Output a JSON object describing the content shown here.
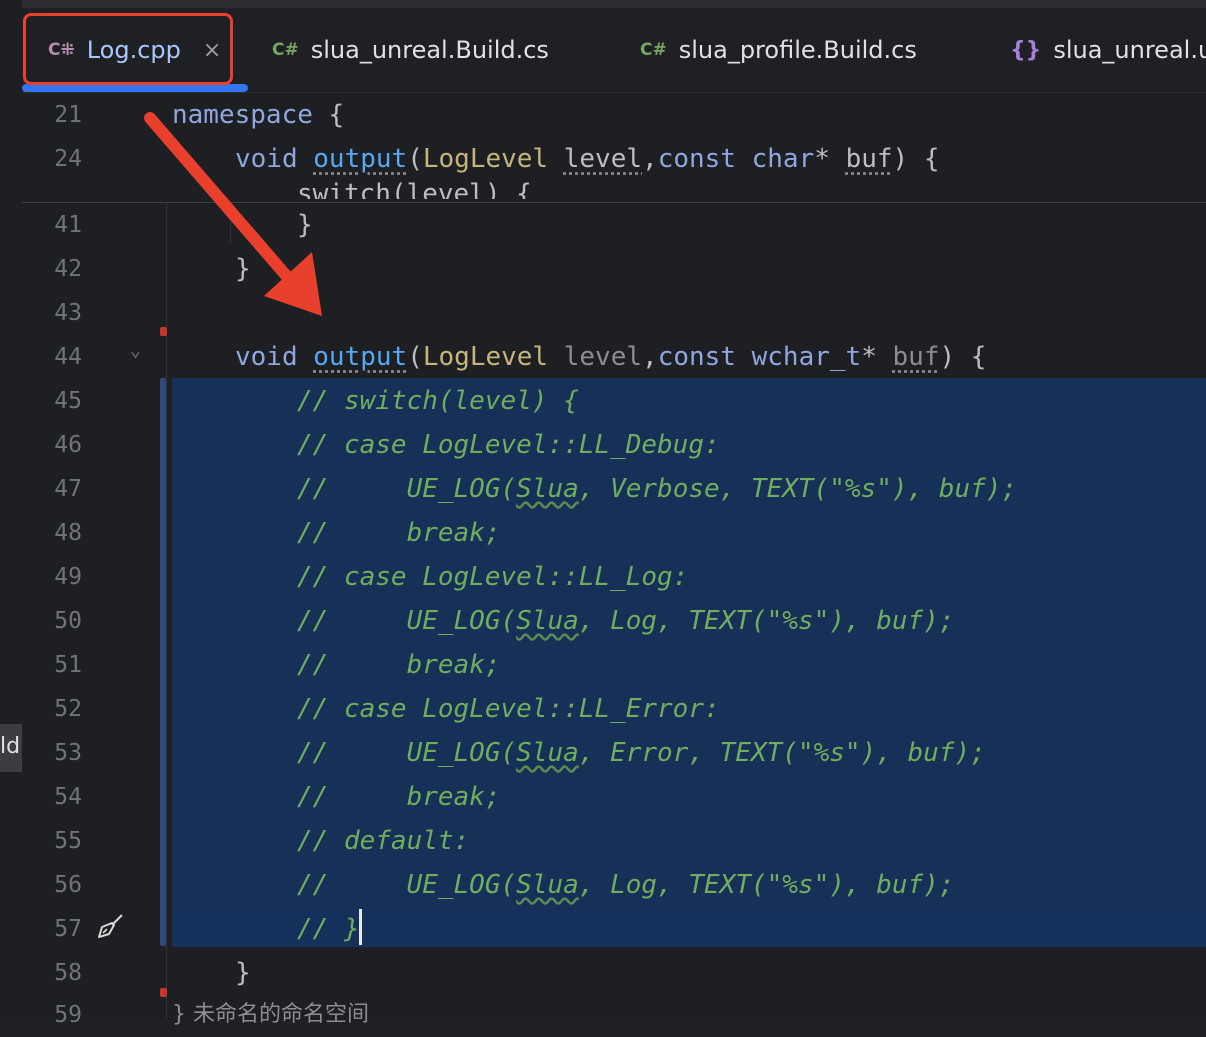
{
  "tabs": [
    {
      "icon": "C⁜",
      "label": "Log.cpp",
      "close": "×"
    },
    {
      "icon": "C#",
      "label": "slua_unreal.Build.cs"
    },
    {
      "icon": "C#",
      "label": "slua_profile.Build.cs"
    },
    {
      "icon": "{}",
      "label": "slua_unreal.u"
    }
  ],
  "left_rail_text": "ld",
  "sticky": {
    "l21": {
      "num": "21",
      "kw": "namespace",
      "rest": " {"
    },
    "l24": {
      "num": "24",
      "kw": "void",
      "fn": "output",
      "t1": "LogLevel",
      "p1": "level",
      "c": "const",
      "t2": "char",
      "p2": "buf",
      "end": ") {"
    },
    "ghost": "switch(level) {"
  },
  "lines": {
    "l41": {
      "num": "41",
      "text": "}"
    },
    "l42": {
      "num": "42",
      "text": "}"
    },
    "l43": {
      "num": "43",
      "text": ""
    },
    "l44": {
      "num": "44",
      "kw": "void",
      "fn": "output",
      "t1": "LogLevel",
      "p1": "level",
      "c": "const",
      "t2": "wchar_t",
      "p2": "buf",
      "end": ") {"
    },
    "l45": {
      "num": "45",
      "text": "// switch(level) {"
    },
    "l46": {
      "num": "46",
      "text": "// case LogLevel::LL_Debug:"
    },
    "l47": {
      "num": "47",
      "a": "//     UE_LOG(",
      "b": "Slua",
      "c": ", Verbose, TEXT(\"%s\"), buf);"
    },
    "l48": {
      "num": "48",
      "text": "//     break;"
    },
    "l49": {
      "num": "49",
      "text": "// case LogLevel::LL_Log:"
    },
    "l50": {
      "num": "50",
      "a": "//     UE_LOG(",
      "b": "Slua",
      "c": ", Log, TEXT(\"%s\"), buf);"
    },
    "l51": {
      "num": "51",
      "text": "//     break;"
    },
    "l52": {
      "num": "52",
      "text": "// case LogLevel::LL_Error:"
    },
    "l53": {
      "num": "53",
      "a": "//     UE_LOG(",
      "b": "Slua",
      "c": ", Error, TEXT(\"%s\"), buf);"
    },
    "l54": {
      "num": "54",
      "text": "//     break;"
    },
    "l55": {
      "num": "55",
      "text": "// default:"
    },
    "l56": {
      "num": "56",
      "a": "//     UE_LOG(",
      "b": "Slua",
      "c": ", Log, TEXT(\"%s\"), buf);"
    },
    "l57": {
      "num": "57",
      "text": "// }"
    },
    "l58": {
      "num": "58",
      "text": "}"
    },
    "l59": {
      "num": "59",
      "text": "} 未命名的命名空间"
    }
  },
  "colors": {
    "selection": "#163057",
    "accent": "#3574f0",
    "annotation": "#e8402d"
  }
}
